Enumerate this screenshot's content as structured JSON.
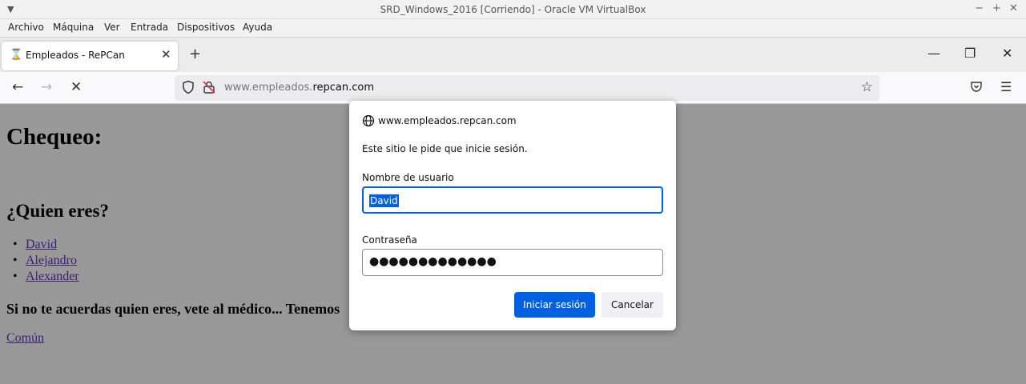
{
  "vbox": {
    "title": "SRD_Windows_2016 [Corriendo] - Oracle VM VirtualBox",
    "menu": [
      "Archivo",
      "Máquina",
      "Ver",
      "Entrada",
      "Dispositivos",
      "Ayuda"
    ]
  },
  "browser": {
    "tab_title": "Empleados - RePCan",
    "url_prefix": "www.empleados.",
    "url_domain": "repcan.com"
  },
  "page": {
    "heading": "Chequeo:",
    "subheading": "¿Quien eres?",
    "links": [
      "David",
      "Alejandro",
      "Alexander"
    ],
    "note": "Si no te acuerdas quien eres, vete al médico... Tenemos",
    "common_link": "Común"
  },
  "dialog": {
    "host": "www.empleados.repcan.com",
    "message": "Este sitio le pide que inicie sesión.",
    "username_label": "Nombre de usuario",
    "username_value": "David",
    "password_label": "Contraseña",
    "password_mask": "●●●●●●●●●●●●●",
    "login_button": "Iniciar sesión",
    "cancel_button": "Cancelar"
  },
  "colors": {
    "accent": "#0061e0",
    "overlay": "#999999"
  }
}
